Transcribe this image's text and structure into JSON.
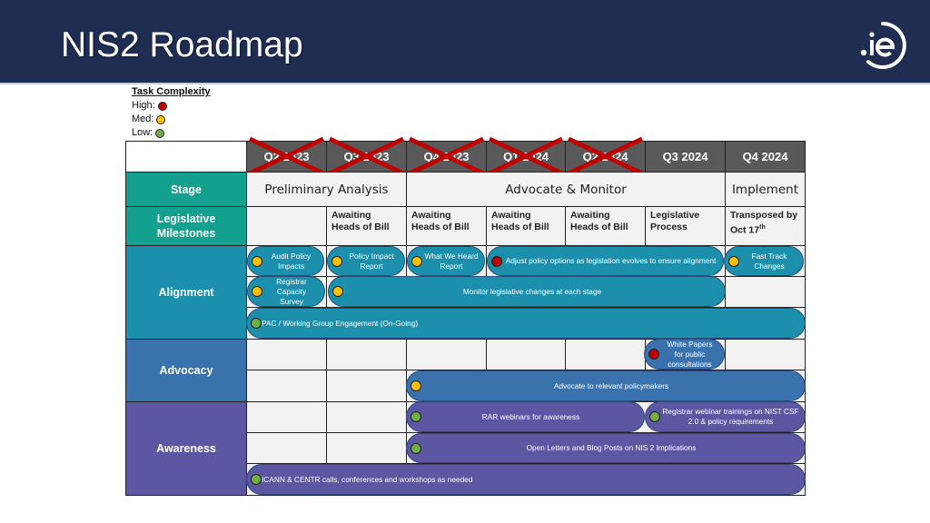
{
  "header": {
    "title": "NIS2 Roadmap",
    "logo_text": ".ie"
  },
  "colors": {
    "header_bg": "#1f2d52",
    "stage_label": "#14a08e",
    "alignment": "#1b8fab",
    "advocacy": "#3a72ad",
    "awareness": "#5b57a3",
    "high": "#c00000",
    "med": "#ffc000",
    "low": "#70ad47",
    "quarter_header": "#595959",
    "strike": "#c00000"
  },
  "legend": {
    "title": "Task Complexity",
    "items": [
      {
        "label": "High:",
        "level": "high"
      },
      {
        "label": "Med:",
        "level": "med"
      },
      {
        "label": "Low:",
        "level": "low"
      }
    ]
  },
  "quarters": [
    {
      "label": "Q2 2023",
      "struck": true
    },
    {
      "label": "Q3 2023",
      "struck": true
    },
    {
      "label": "Q4 2023",
      "struck": true
    },
    {
      "label": "Q1 2024",
      "struck": true
    },
    {
      "label": "Q2 2024",
      "struck": true
    },
    {
      "label": "Q3 2024",
      "struck": false
    },
    {
      "label": "Q4 2024",
      "struck": false
    }
  ],
  "row_labels": {
    "stage": "Stage",
    "milestones_line1": "Legislative",
    "milestones_line2": "Milestones",
    "alignment": "Alignment",
    "advocacy": "Advocacy",
    "awareness": "Awareness"
  },
  "stages": [
    {
      "label": "Preliminary Analysis",
      "span": "Q2 2023 – Q3 2023"
    },
    {
      "label": "Advocate & Monitor",
      "span": "Q4 2023 – Q3 2024"
    },
    {
      "label": "Implement",
      "span": "Q4 2024"
    }
  ],
  "milestones": [
    {
      "line1": "",
      "line2": ""
    },
    {
      "line1": "Awaiting",
      "line2": "Heads of Bill"
    },
    {
      "line1": "Awaiting",
      "line2": "Heads of Bill"
    },
    {
      "line1": "Awaiting",
      "line2": "Heads of Bill"
    },
    {
      "line1": "Awaiting",
      "line2": "Heads of Bill"
    },
    {
      "line1": "Legislative",
      "line2": "Process"
    },
    {
      "line1": "Transposed by",
      "line2": "Oct 17",
      "sup": "th"
    }
  ],
  "tasks": {
    "alignment": [
      {
        "text": "Audit Policy Impacts",
        "complexity": "med"
      },
      {
        "text": "Policy Impact Report",
        "complexity": "med"
      },
      {
        "text": "What We Heard Report",
        "complexity": "med"
      },
      {
        "text": "Adjust policy options as legislation evolves to ensure alignment",
        "complexity": "high"
      },
      {
        "text": "Fast Track Changes",
        "complexity": "med"
      },
      {
        "text": "Registrar Capacity Survey",
        "complexity": "med"
      },
      {
        "text": "Monitor legislative changes at each stage",
        "complexity": "med"
      },
      {
        "text": "PAC / Working Group Engagement (On-Going)",
        "complexity": "low"
      }
    ],
    "advocacy": [
      {
        "text": "White Papers for public consultations",
        "complexity": "high"
      },
      {
        "text": "Advocate to relevant policymakers",
        "complexity": "med"
      }
    ],
    "awareness": [
      {
        "text": "RAR webinars for awareness",
        "complexity": "low"
      },
      {
        "text": "Registrar webinar trainings on NIST CSF 2.0 & policy requirements",
        "complexity": "low"
      },
      {
        "text": "Open Letters and Blog Posts on NIS 2 Implications",
        "complexity": "low"
      },
      {
        "text": "ICANN & CENTR calls, conferences and workshops as needed",
        "complexity": "low"
      }
    ]
  }
}
